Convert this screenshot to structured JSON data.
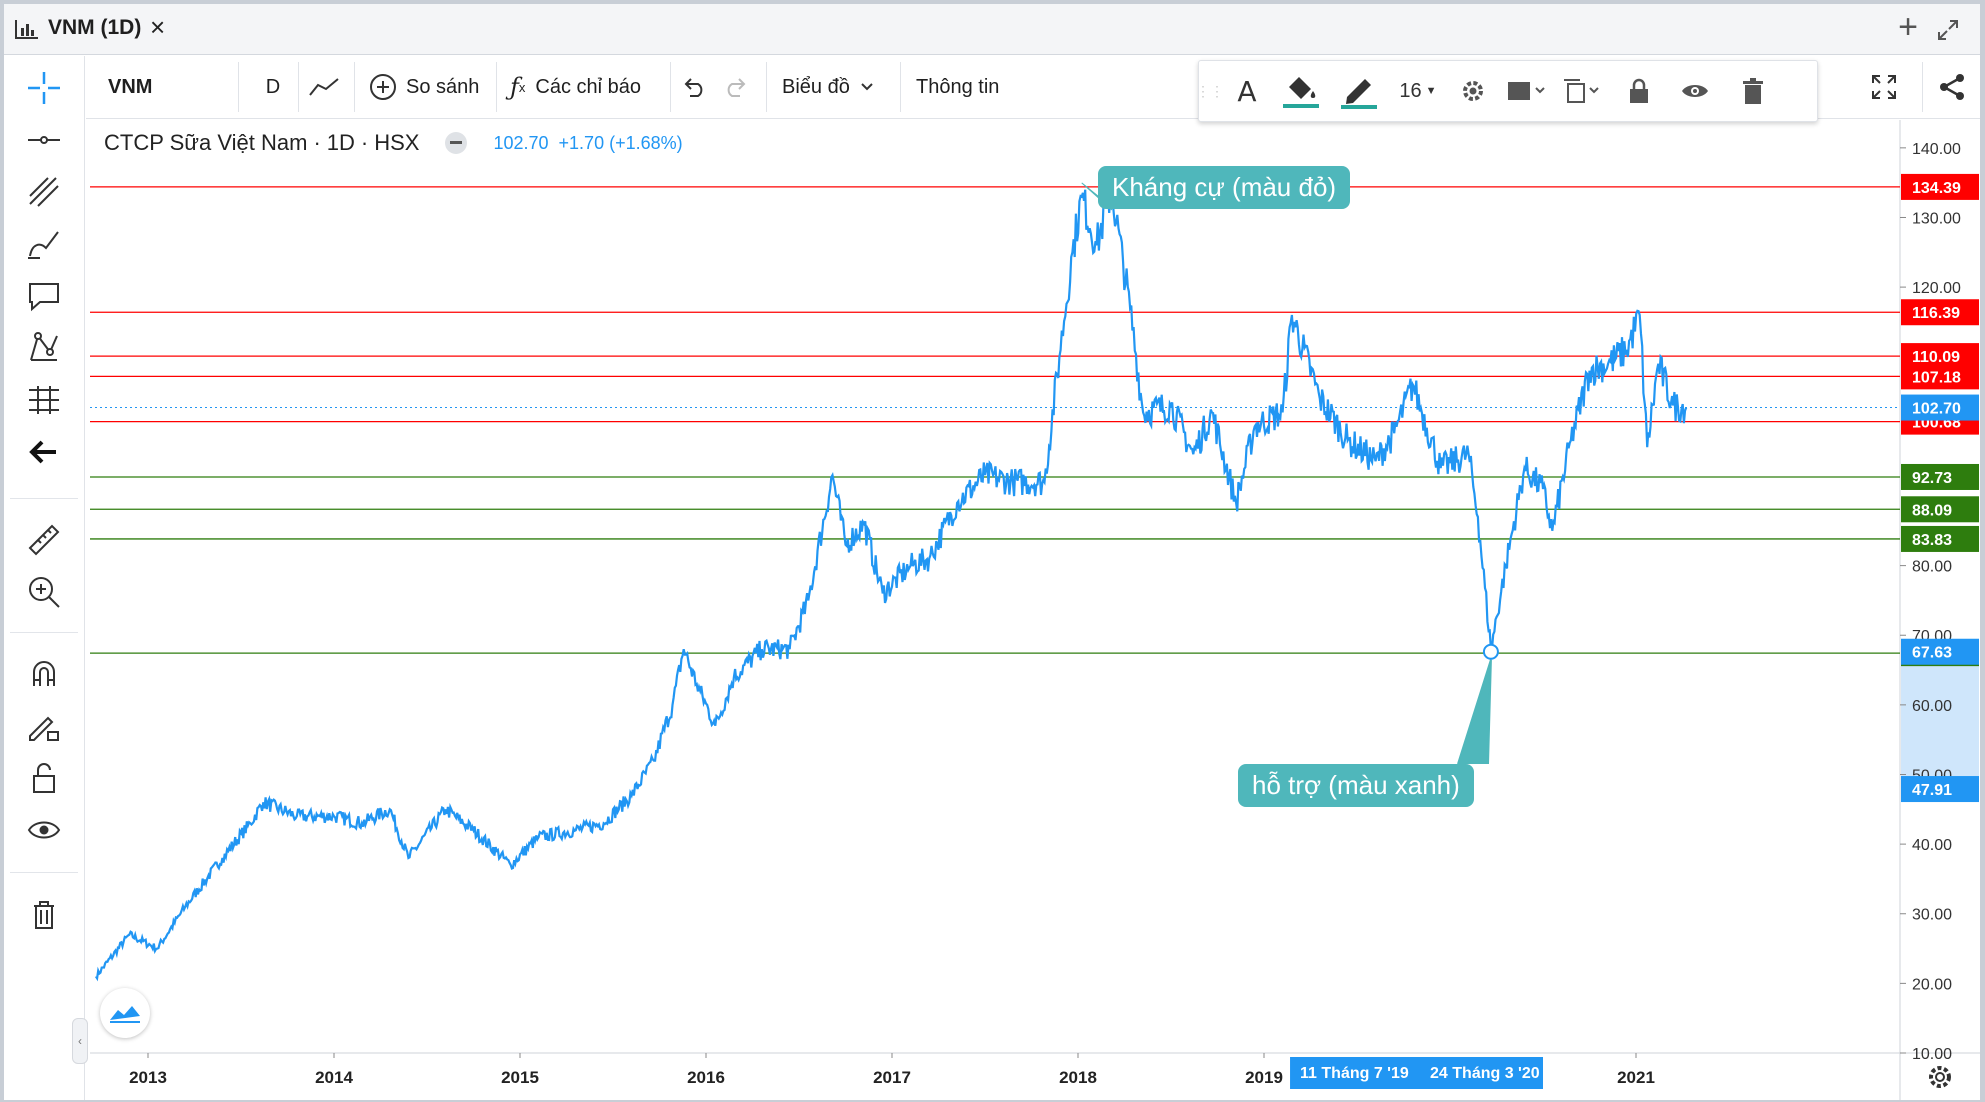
{
  "window": {
    "title": "VNM (1D)",
    "close": "×",
    "add": "+"
  },
  "toolbar": {
    "symbol": "VNM",
    "interval": "D",
    "compare_label": "So sánh",
    "indicators_label": "Các chỉ báo",
    "chart_label": "Biểu đồ",
    "info_label": "Thông tin"
  },
  "drawing_toolbar": {
    "font_size": "16"
  },
  "legend": {
    "name": "CTCP Sữa Việt Nam",
    "dot1": "·",
    "interval": "1D",
    "dot2": "·",
    "exchange": "HSX",
    "price": "102.70",
    "change": "+1.70 (+1.68%)"
  },
  "annotations": {
    "resistance": "Kháng cự (màu đỏ)",
    "support": "hỗ trợ (màu xanh)"
  },
  "colors": {
    "line": "#2196f3",
    "resistance": "#ff0000",
    "support": "#2e7d0e",
    "price_badge": "#2196f3",
    "callout": "#4fb7bb"
  },
  "chart_data": {
    "type": "line",
    "title": "",
    "xlabel": "",
    "ylabel": "",
    "ylim": [
      10,
      144
    ],
    "x_ticks": [
      "2013",
      "2014",
      "2015",
      "2016",
      "2017",
      "2018",
      "2019",
      "2021"
    ],
    "x_highlight_labels": [
      "11 Tháng 7 '19",
      "24 Tháng 3 '20"
    ],
    "y_ticks": [
      "140.00",
      "130.00",
      "120.00",
      "80.00",
      "70.00",
      "60.00",
      "50.00",
      "40.00",
      "30.00",
      "20.00",
      "10.00"
    ],
    "resistance_levels": [
      "134.39",
      "116.39",
      "110.09",
      "107.18",
      "100.68"
    ],
    "support_levels": [
      "92.73",
      "88.09",
      "83.83",
      "67.43"
    ],
    "other_price_labels": [
      "102.70",
      "67.63",
      "47.91"
    ],
    "series": [
      {
        "values": [
          [
            2012.72,
            21
          ],
          [
            2012.9,
            27
          ],
          [
            2013.05,
            25
          ],
          [
            2013.2,
            31
          ],
          [
            2013.4,
            38
          ],
          [
            2013.55,
            43
          ],
          [
            2013.62,
            46
          ],
          [
            2013.8,
            44
          ],
          [
            2014.0,
            44
          ],
          [
            2014.15,
            43
          ],
          [
            2014.3,
            45
          ],
          [
            2014.4,
            38
          ],
          [
            2014.6,
            45
          ],
          [
            2014.75,
            42
          ],
          [
            2014.95,
            37
          ],
          [
            2015.1,
            41
          ],
          [
            2015.3,
            42
          ],
          [
            2015.45,
            43
          ],
          [
            2015.6,
            47
          ],
          [
            2015.72,
            52
          ],
          [
            2015.82,
            60
          ],
          [
            2015.88,
            68
          ],
          [
            2015.95,
            63
          ],
          [
            2016.05,
            57
          ],
          [
            2016.15,
            64
          ],
          [
            2016.3,
            68
          ],
          [
            2016.45,
            68
          ],
          [
            2016.55,
            75
          ],
          [
            2016.68,
            93
          ],
          [
            2016.75,
            83
          ],
          [
            2016.85,
            86
          ],
          [
            2016.95,
            76
          ],
          [
            2017.1,
            80
          ],
          [
            2017.2,
            81
          ],
          [
            2017.35,
            89
          ],
          [
            2017.5,
            93
          ],
          [
            2017.65,
            92
          ],
          [
            2017.82,
            92
          ],
          [
            2017.9,
            110
          ],
          [
            2017.97,
            125
          ],
          [
            2018.02,
            133
          ],
          [
            2018.1,
            126
          ],
          [
            2018.18,
            134
          ],
          [
            2018.28,
            117
          ],
          [
            2018.35,
            102
          ],
          [
            2018.5,
            103
          ],
          [
            2018.62,
            96
          ],
          [
            2018.72,
            102
          ],
          [
            2018.85,
            89
          ],
          [
            2018.95,
            100
          ],
          [
            2019.1,
            102
          ],
          [
            2019.15,
            116
          ],
          [
            2019.3,
            104
          ],
          [
            2019.45,
            98
          ],
          [
            2019.6,
            95
          ],
          [
            2019.7,
            99
          ],
          [
            2019.8,
            106
          ],
          [
            2019.95,
            94
          ],
          [
            2020.1,
            96
          ],
          [
            2020.15,
            87
          ],
          [
            2020.22,
            68
          ],
          [
            2020.3,
            80
          ],
          [
            2020.4,
            94
          ],
          [
            2020.5,
            91
          ],
          [
            2020.55,
            85
          ],
          [
            2020.65,
            98
          ],
          [
            2020.75,
            108
          ],
          [
            2020.85,
            109
          ],
          [
            2020.95,
            111
          ],
          [
            2021.02,
            116
          ],
          [
            2021.06,
            97
          ],
          [
            2021.12,
            109
          ],
          [
            2021.2,
            103
          ],
          [
            2021.27,
            102.7
          ]
        ]
      }
    ],
    "grid": false,
    "legend_position": "top-left"
  }
}
